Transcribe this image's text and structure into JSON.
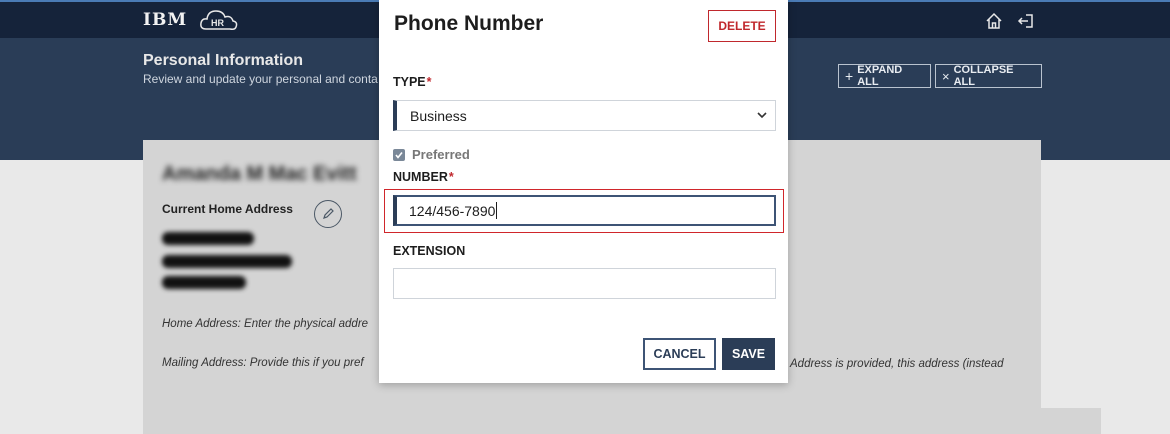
{
  "app": {
    "logo_text": "IBM",
    "hr_logo_label": "HR"
  },
  "header": {
    "icons": [
      "home-icon",
      "logout-icon"
    ]
  },
  "banner": {
    "title": "Personal Information",
    "subtitle": "Review and update your personal and conta",
    "expand_all": "EXPAND ALL",
    "collapse_all": "COLLAPSE ALL"
  },
  "profile": {
    "name": "Amanda M Mac Evitt",
    "address_label": "Current Home Address",
    "hint_home": "Home Address: Enter the physical addre",
    "hint_mailing": "Mailing Address: Provide this if you pref",
    "hint_right": "Address is provided, this address (instead"
  },
  "modal": {
    "title": "Phone Number",
    "delete_label": "DELETE",
    "type_label": "TYPE",
    "required_mark": "*",
    "type_value": "Business",
    "preferred_label": "Preferred",
    "preferred_checked": true,
    "number_label": "NUMBER",
    "number_value": "124/456-7890",
    "extension_label": "EXTENSION",
    "extension_value": "",
    "cancel_label": "CANCEL",
    "save_label": "SAVE"
  },
  "colors": {
    "nav_bg": "#15233a",
    "banner_bg": "#2a3d57",
    "primary": "#2b3d57",
    "danger": "#c0282d"
  }
}
